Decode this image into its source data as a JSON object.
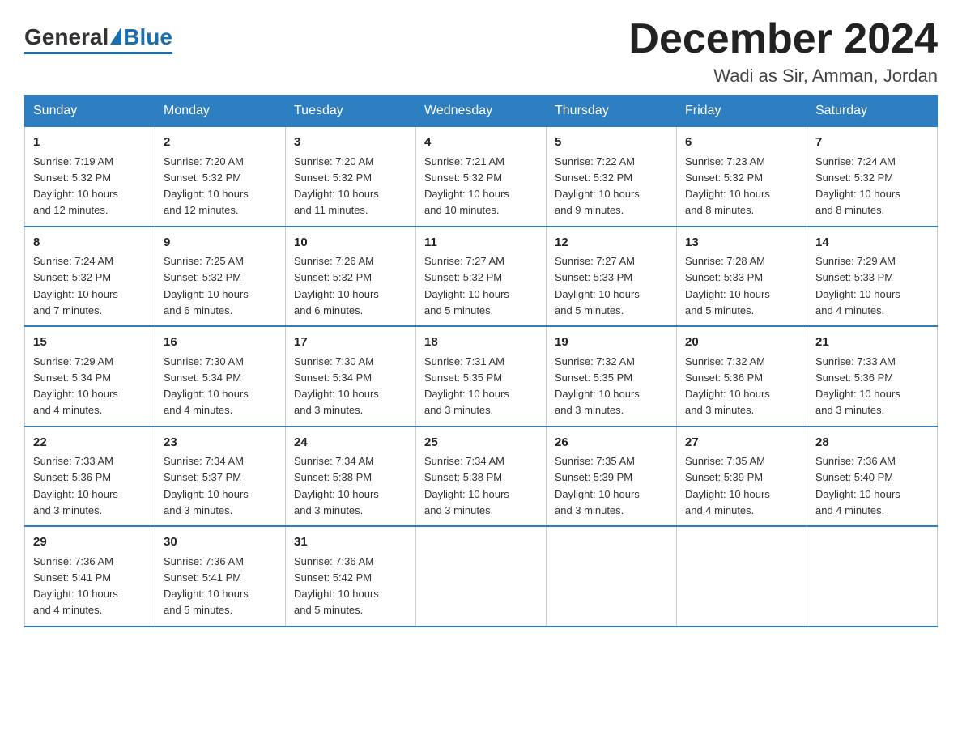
{
  "header": {
    "title": "December 2024",
    "location": "Wadi as Sir, Amman, Jordan",
    "logo_general": "General",
    "logo_blue": "Blue"
  },
  "days_of_week": [
    "Sunday",
    "Monday",
    "Tuesday",
    "Wednesday",
    "Thursday",
    "Friday",
    "Saturday"
  ],
  "weeks": [
    [
      {
        "day": "1",
        "sunrise": "7:19 AM",
        "sunset": "5:32 PM",
        "daylight": "10 hours and 12 minutes."
      },
      {
        "day": "2",
        "sunrise": "7:20 AM",
        "sunset": "5:32 PM",
        "daylight": "10 hours and 12 minutes."
      },
      {
        "day": "3",
        "sunrise": "7:20 AM",
        "sunset": "5:32 PM",
        "daylight": "10 hours and 11 minutes."
      },
      {
        "day": "4",
        "sunrise": "7:21 AM",
        "sunset": "5:32 PM",
        "daylight": "10 hours and 10 minutes."
      },
      {
        "day": "5",
        "sunrise": "7:22 AM",
        "sunset": "5:32 PM",
        "daylight": "10 hours and 9 minutes."
      },
      {
        "day": "6",
        "sunrise": "7:23 AM",
        "sunset": "5:32 PM",
        "daylight": "10 hours and 8 minutes."
      },
      {
        "day": "7",
        "sunrise": "7:24 AM",
        "sunset": "5:32 PM",
        "daylight": "10 hours and 8 minutes."
      }
    ],
    [
      {
        "day": "8",
        "sunrise": "7:24 AM",
        "sunset": "5:32 PM",
        "daylight": "10 hours and 7 minutes."
      },
      {
        "day": "9",
        "sunrise": "7:25 AM",
        "sunset": "5:32 PM",
        "daylight": "10 hours and 6 minutes."
      },
      {
        "day": "10",
        "sunrise": "7:26 AM",
        "sunset": "5:32 PM",
        "daylight": "10 hours and 6 minutes."
      },
      {
        "day": "11",
        "sunrise": "7:27 AM",
        "sunset": "5:32 PM",
        "daylight": "10 hours and 5 minutes."
      },
      {
        "day": "12",
        "sunrise": "7:27 AM",
        "sunset": "5:33 PM",
        "daylight": "10 hours and 5 minutes."
      },
      {
        "day": "13",
        "sunrise": "7:28 AM",
        "sunset": "5:33 PM",
        "daylight": "10 hours and 5 minutes."
      },
      {
        "day": "14",
        "sunrise": "7:29 AM",
        "sunset": "5:33 PM",
        "daylight": "10 hours and 4 minutes."
      }
    ],
    [
      {
        "day": "15",
        "sunrise": "7:29 AM",
        "sunset": "5:34 PM",
        "daylight": "10 hours and 4 minutes."
      },
      {
        "day": "16",
        "sunrise": "7:30 AM",
        "sunset": "5:34 PM",
        "daylight": "10 hours and 4 minutes."
      },
      {
        "day": "17",
        "sunrise": "7:30 AM",
        "sunset": "5:34 PM",
        "daylight": "10 hours and 3 minutes."
      },
      {
        "day": "18",
        "sunrise": "7:31 AM",
        "sunset": "5:35 PM",
        "daylight": "10 hours and 3 minutes."
      },
      {
        "day": "19",
        "sunrise": "7:32 AM",
        "sunset": "5:35 PM",
        "daylight": "10 hours and 3 minutes."
      },
      {
        "day": "20",
        "sunrise": "7:32 AM",
        "sunset": "5:36 PM",
        "daylight": "10 hours and 3 minutes."
      },
      {
        "day": "21",
        "sunrise": "7:33 AM",
        "sunset": "5:36 PM",
        "daylight": "10 hours and 3 minutes."
      }
    ],
    [
      {
        "day": "22",
        "sunrise": "7:33 AM",
        "sunset": "5:36 PM",
        "daylight": "10 hours and 3 minutes."
      },
      {
        "day": "23",
        "sunrise": "7:34 AM",
        "sunset": "5:37 PM",
        "daylight": "10 hours and 3 minutes."
      },
      {
        "day": "24",
        "sunrise": "7:34 AM",
        "sunset": "5:38 PM",
        "daylight": "10 hours and 3 minutes."
      },
      {
        "day": "25",
        "sunrise": "7:34 AM",
        "sunset": "5:38 PM",
        "daylight": "10 hours and 3 minutes."
      },
      {
        "day": "26",
        "sunrise": "7:35 AM",
        "sunset": "5:39 PM",
        "daylight": "10 hours and 3 minutes."
      },
      {
        "day": "27",
        "sunrise": "7:35 AM",
        "sunset": "5:39 PM",
        "daylight": "10 hours and 4 minutes."
      },
      {
        "day": "28",
        "sunrise": "7:36 AM",
        "sunset": "5:40 PM",
        "daylight": "10 hours and 4 minutes."
      }
    ],
    [
      {
        "day": "29",
        "sunrise": "7:36 AM",
        "sunset": "5:41 PM",
        "daylight": "10 hours and 4 minutes."
      },
      {
        "day": "30",
        "sunrise": "7:36 AM",
        "sunset": "5:41 PM",
        "daylight": "10 hours and 5 minutes."
      },
      {
        "day": "31",
        "sunrise": "7:36 AM",
        "sunset": "5:42 PM",
        "daylight": "10 hours and 5 minutes."
      },
      null,
      null,
      null,
      null
    ]
  ],
  "labels": {
    "sunrise": "Sunrise:",
    "sunset": "Sunset:",
    "daylight": "Daylight:"
  }
}
